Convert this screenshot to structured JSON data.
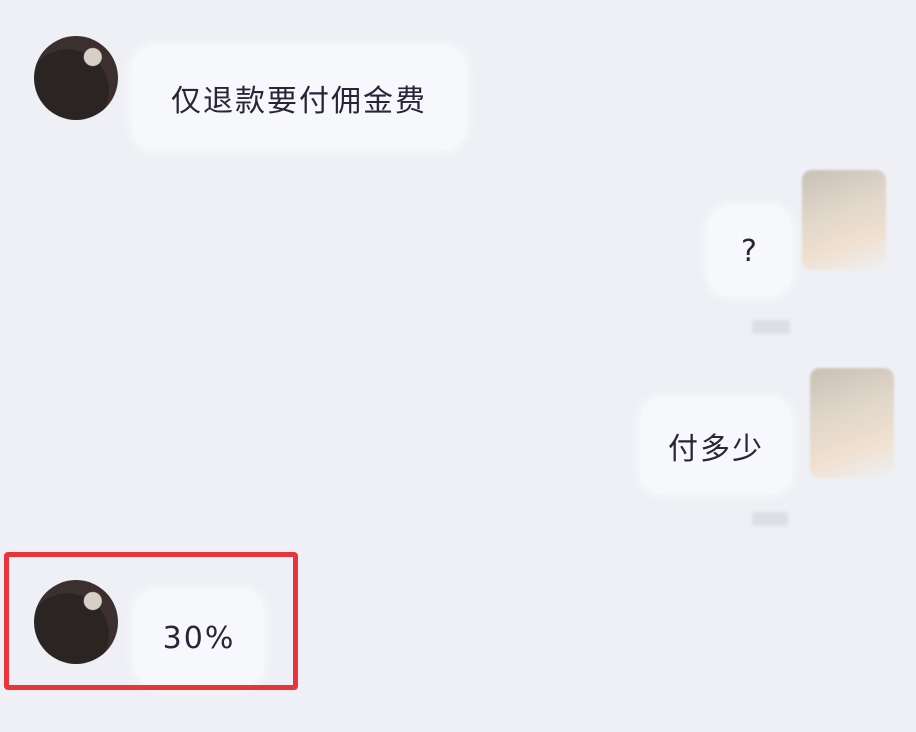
{
  "messages": [
    {
      "side": "left",
      "text": "仅退款要付佣金费"
    },
    {
      "side": "right",
      "text": "?"
    },
    {
      "side": "right",
      "text": "付多少"
    },
    {
      "side": "left",
      "text": "30%"
    }
  ],
  "colors": {
    "background": "#eef0f5",
    "bubble": "#f7f8fb",
    "text": "#2a2536",
    "highlight_border": "#e8343a"
  }
}
